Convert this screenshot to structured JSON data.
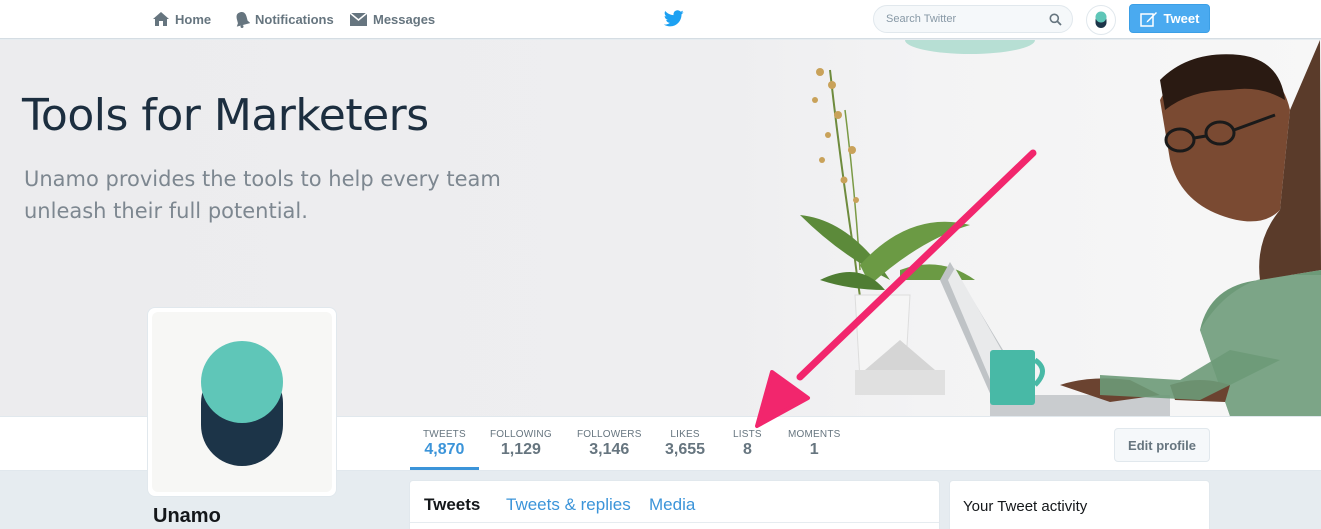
{
  "nav": {
    "home_label": "Home",
    "notifications_label": "Notifications",
    "messages_label": "Messages",
    "search_placeholder": "Search Twitter",
    "tweet_button_label": "Tweet"
  },
  "banner": {
    "title": "Tools for Marketers",
    "subtitle": "Unamo provides the tools to help every team unleash their full potential."
  },
  "stats": [
    {
      "label": "TWEETS",
      "value": "4,870",
      "active": true
    },
    {
      "label": "FOLLOWING",
      "value": "1,129"
    },
    {
      "label": "FOLLOWERS",
      "value": "3,146"
    },
    {
      "label": "LIKES",
      "value": "3,655"
    },
    {
      "label": "LISTS",
      "value": "8"
    },
    {
      "label": "MOMENTS",
      "value": "1"
    }
  ],
  "profile": {
    "edit_button_label": "Edit profile",
    "name": "Unamo"
  },
  "tabs": [
    {
      "label": "Tweets",
      "active": true
    },
    {
      "label": "Tweets & replies"
    },
    {
      "label": "Media"
    }
  ],
  "activity": {
    "title": "Your Tweet activity"
  },
  "colors": {
    "twitter_blue": "#1da1f2",
    "tweet_button": "#4aaaf0",
    "link_blue": "#3b94d9",
    "logo_teal": "#5fc6b8",
    "logo_navy": "#1c3448",
    "annotation_arrow": "#f2266d"
  }
}
